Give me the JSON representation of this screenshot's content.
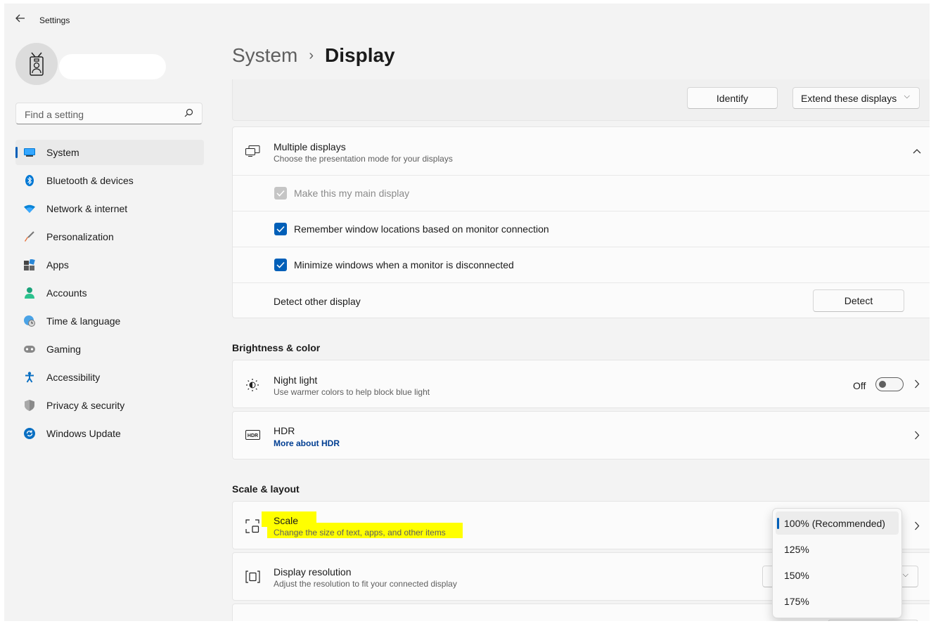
{
  "app": {
    "title": "Settings",
    "back_icon": "back-arrow-icon"
  },
  "search": {
    "placeholder": "Find a setting"
  },
  "nav": {
    "items": [
      {
        "label": "System",
        "icon": "monitor-icon",
        "active": true
      },
      {
        "label": "Bluetooth & devices",
        "icon": "bluetooth-icon"
      },
      {
        "label": "Network & internet",
        "icon": "wifi-icon"
      },
      {
        "label": "Personalization",
        "icon": "brush-icon"
      },
      {
        "label": "Apps",
        "icon": "apps-icon"
      },
      {
        "label": "Accounts",
        "icon": "person-icon"
      },
      {
        "label": "Time & language",
        "icon": "globe-clock-icon"
      },
      {
        "label": "Gaming",
        "icon": "gamepad-icon"
      },
      {
        "label": "Accessibility",
        "icon": "accessibility-icon"
      },
      {
        "label": "Privacy & security",
        "icon": "shield-icon"
      },
      {
        "label": "Windows Update",
        "icon": "update-icon"
      }
    ]
  },
  "breadcrumb": {
    "parent": "System",
    "separator": "›",
    "current": "Display"
  },
  "display_arrangement": {
    "identify_label": "Identify",
    "mode_label": "Extend these displays"
  },
  "multiple_displays": {
    "title": "Multiple displays",
    "subtitle": "Choose the presentation mode for your displays",
    "options": [
      {
        "label": "Make this my main display",
        "checked": true,
        "disabled": true
      },
      {
        "label": "Remember window locations based on monitor connection",
        "checked": true,
        "disabled": false
      },
      {
        "label": "Minimize windows when a monitor is disconnected",
        "checked": true,
        "disabled": false
      }
    ],
    "detect": {
      "label": "Detect other display",
      "button": "Detect"
    }
  },
  "brightness_color": {
    "heading": "Brightness & color",
    "night_light": {
      "title": "Night light",
      "subtitle": "Use warmer colors to help block blue light",
      "state": "Off"
    },
    "hdr": {
      "title": "HDR",
      "link": "More about HDR"
    }
  },
  "scale_layout": {
    "heading": "Scale & layout",
    "scale": {
      "title": "Scale",
      "subtitle": "Change the size of text, apps, and other items"
    },
    "resolution": {
      "title": "Display resolution",
      "subtitle": "Adjust the resolution to fit your connected display"
    }
  },
  "scale_dropdown": {
    "options": [
      "100% (Recommended)",
      "125%",
      "150%",
      "175%"
    ],
    "selected": "100% (Recommended)"
  },
  "colors": {
    "accent": "#005fb8",
    "highlight": "#ffff00",
    "link": "#003e92"
  }
}
